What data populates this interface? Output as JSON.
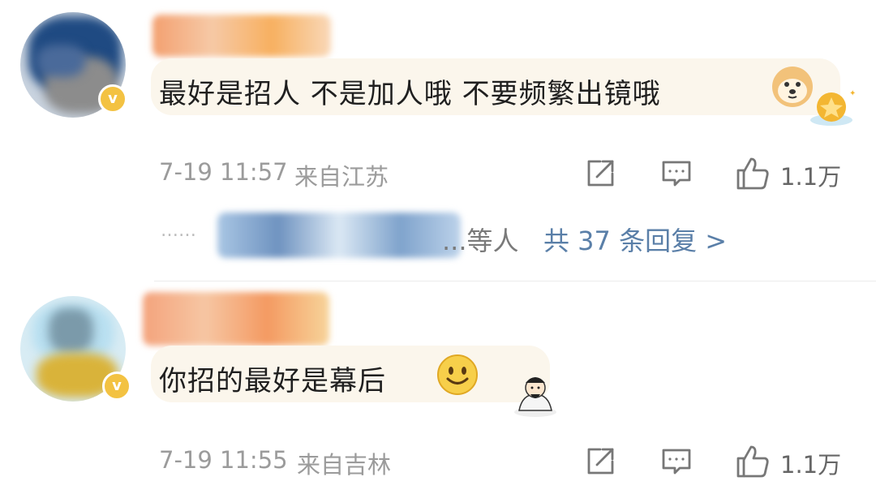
{
  "comments": [
    {
      "text": "最好是招人 不是加人哦  不要频繁出镜哦",
      "time": "7-19 11:57",
      "location": "来自江苏",
      "likes": "1.1万",
      "verified_icon": "v-badge-icon",
      "emojis": [
        "doge-emoji",
        "gold-star-badge-icon"
      ]
    },
    {
      "text": "你招的最好是幕后",
      "time": "7-19 11:55",
      "location": "来自吉林",
      "likes": "1.1万",
      "verified_icon": "v-badge-icon",
      "emojis": [
        "smile-emoji",
        "scholar-sticker"
      ]
    }
  ],
  "reply_summary": {
    "dots": "……",
    "others": "...等人",
    "link": "共 37 条回复 >"
  },
  "actions": {
    "icons": [
      "share-icon",
      "comment-icon",
      "like-icon"
    ]
  },
  "colors": {
    "link": "#5a7fa8",
    "meta": "#9b9b9b",
    "badge": "#f3c242"
  }
}
